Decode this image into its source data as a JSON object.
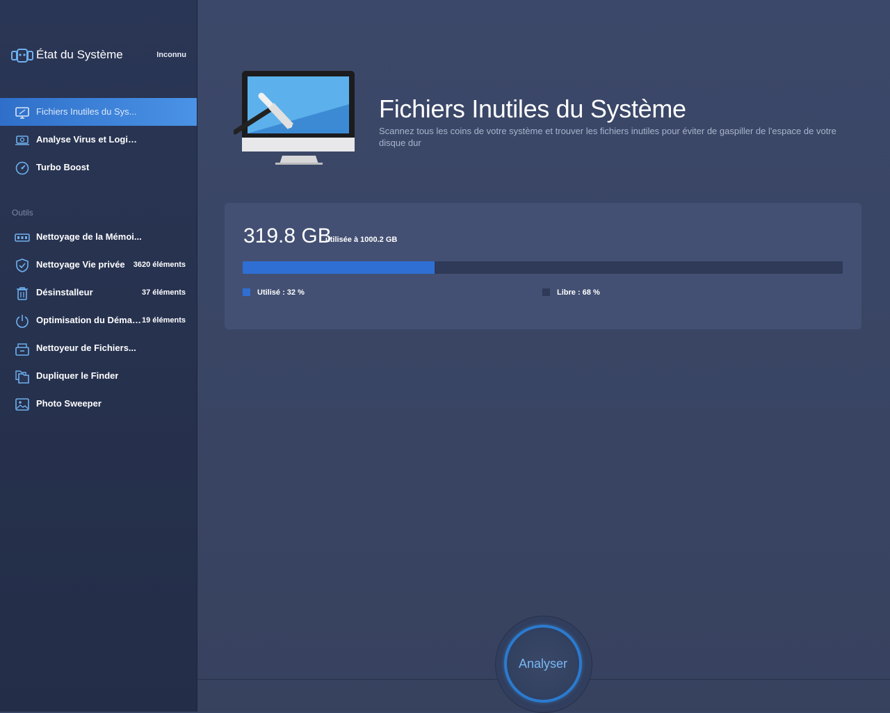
{
  "header": {
    "title": "État du Système",
    "status": "Inconnu"
  },
  "sidebar": {
    "main_items": [
      {
        "label": "Fichiers Inutiles du Sys...",
        "icon": "monitor-icon",
        "active": true
      },
      {
        "label": "Analyse Virus et Logici...",
        "icon": "laptop-scan-icon"
      },
      {
        "label": "Turbo Boost",
        "icon": "speedometer-icon"
      }
    ],
    "section_label": "Outils",
    "tool_items": [
      {
        "label": "Nettoyage de la Mémoi...",
        "count": "",
        "icon": "memory-chip-icon"
      },
      {
        "label": "Nettoyage Vie privée",
        "count": "3620 éléments",
        "icon": "shield-check-icon"
      },
      {
        "label": "Désinstalleur",
        "count": "37 éléments",
        "icon": "trash-icon"
      },
      {
        "label": "Optimisation du Démar...",
        "count": "19 éléments",
        "icon": "power-icon"
      },
      {
        "label": "Nettoyeur de Fichiers...",
        "count": "",
        "icon": "file-box-icon"
      },
      {
        "label": "Dupliquer le Finder",
        "count": "",
        "icon": "duplicate-folder-icon"
      },
      {
        "label": "Photo Sweeper",
        "count": "",
        "icon": "photo-icon"
      }
    ]
  },
  "main": {
    "title": "Fichiers Inutiles du Système",
    "description": "Scannez tous les coins de votre système et trouver les fichiers inutiles pour éviter de gaspiller de l'espace de votre disque dur",
    "disk": {
      "used": "319.8 GB",
      "total_text": "utilisée à 1000.2 GB",
      "used_fraction": 0.32,
      "used_label": "Utilisé : 32 %",
      "free_label": "Libre : 68 %",
      "used_color": "#2f6fd4",
      "free_color": "#2e3a57"
    },
    "scan_button": "Analyser"
  },
  "colors": {
    "accent": "#2f6fd4",
    "active_nav": "#4a93e6",
    "button_text": "#77b8f5"
  }
}
